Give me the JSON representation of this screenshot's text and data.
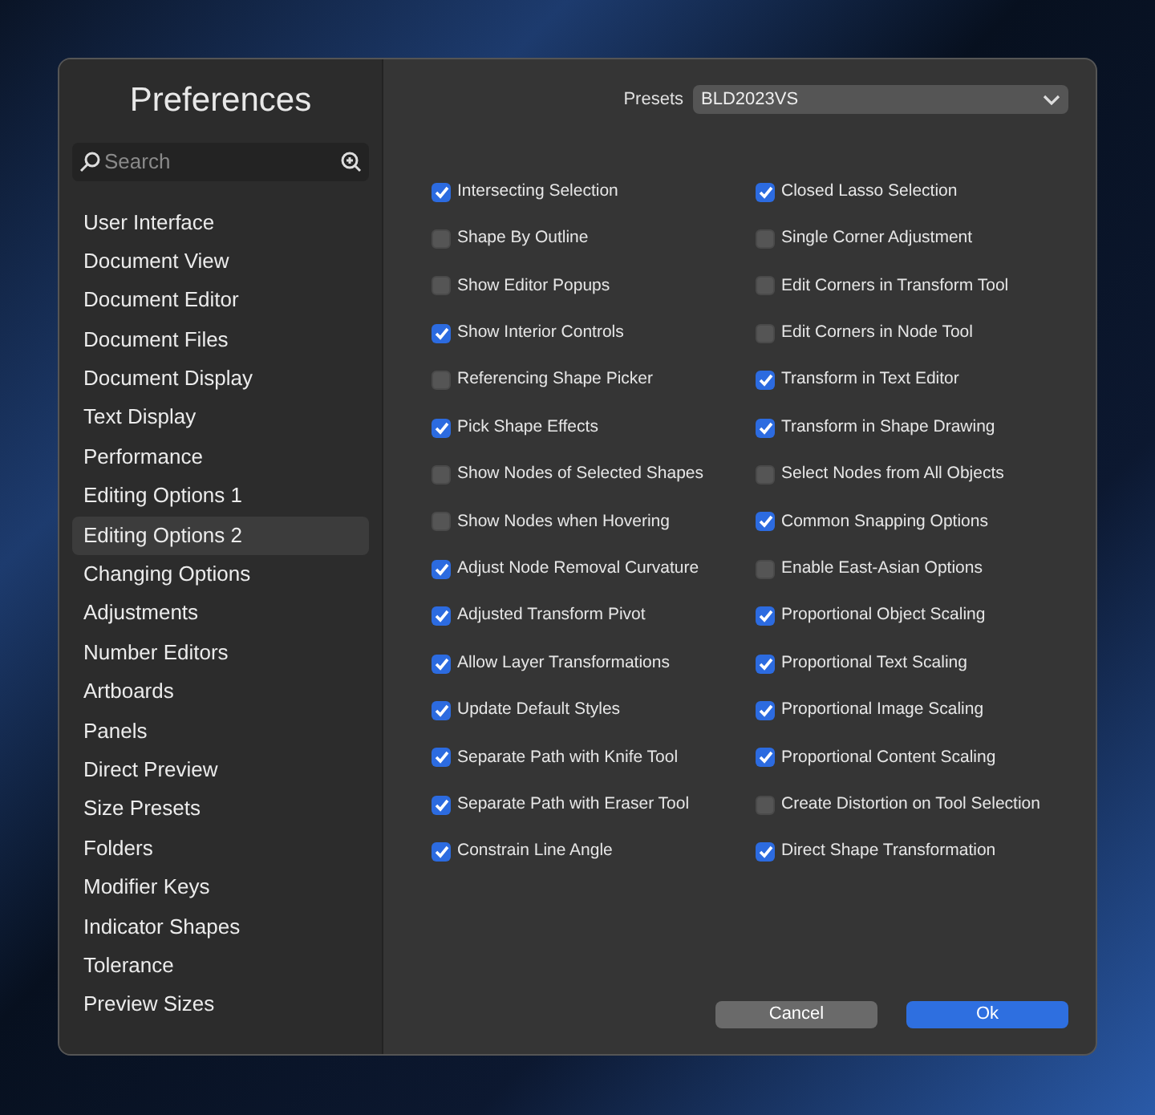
{
  "window": {
    "title": "Preferences"
  },
  "search": {
    "placeholder": "Search"
  },
  "sidebar": {
    "items": [
      {
        "label": "User Interface",
        "selected": false
      },
      {
        "label": "Document View",
        "selected": false
      },
      {
        "label": "Document Editor",
        "selected": false
      },
      {
        "label": "Document Files",
        "selected": false
      },
      {
        "label": "Document Display",
        "selected": false
      },
      {
        "label": "Text Display",
        "selected": false
      },
      {
        "label": "Performance",
        "selected": false
      },
      {
        "label": "Editing Options 1",
        "selected": false
      },
      {
        "label": "Editing Options 2",
        "selected": true
      },
      {
        "label": "Changing Options",
        "selected": false
      },
      {
        "label": "Adjustments",
        "selected": false
      },
      {
        "label": "Number Editors",
        "selected": false
      },
      {
        "label": "Artboards",
        "selected": false
      },
      {
        "label": "Panels",
        "selected": false
      },
      {
        "label": "Direct Preview",
        "selected": false
      },
      {
        "label": "Size Presets",
        "selected": false
      },
      {
        "label": "Folders",
        "selected": false
      },
      {
        "label": "Modifier Keys",
        "selected": false
      },
      {
        "label": "Indicator Shapes",
        "selected": false
      },
      {
        "label": "Tolerance",
        "selected": false
      },
      {
        "label": "Preview Sizes",
        "selected": false
      }
    ]
  },
  "presets": {
    "label": "Presets",
    "value": "BLD2023VS"
  },
  "options": [
    {
      "label": "Intersecting Selection",
      "checked": true
    },
    {
      "label": "Closed Lasso Selection",
      "checked": true
    },
    {
      "label": "Shape By Outline",
      "checked": false
    },
    {
      "label": "Single Corner Adjustment",
      "checked": false
    },
    {
      "label": "Show Editor Popups",
      "checked": false
    },
    {
      "label": "Edit Corners in Transform Tool",
      "checked": false
    },
    {
      "label": "Show Interior Controls",
      "checked": true
    },
    {
      "label": "Edit Corners in Node Tool",
      "checked": false
    },
    {
      "label": "Referencing Shape Picker",
      "checked": false
    },
    {
      "label": "Transform in Text Editor",
      "checked": true
    },
    {
      "label": "Pick Shape Effects",
      "checked": true
    },
    {
      "label": "Transform in Shape Drawing",
      "checked": true
    },
    {
      "label": "Show Nodes of Selected Shapes",
      "checked": false
    },
    {
      "label": "Select Nodes from All Objects",
      "checked": false
    },
    {
      "label": "Show Nodes when Hovering",
      "checked": false
    },
    {
      "label": "Common Snapping Options",
      "checked": true
    },
    {
      "label": "Adjust Node Removal Curvature",
      "checked": true
    },
    {
      "label": "Enable East-Asian Options",
      "checked": false
    },
    {
      "label": "Adjusted Transform Pivot",
      "checked": true
    },
    {
      "label": "Proportional Object Scaling",
      "checked": true
    },
    {
      "label": "Allow Layer Transformations",
      "checked": true
    },
    {
      "label": "Proportional Text Scaling",
      "checked": true
    },
    {
      "label": "Update Default Styles",
      "checked": true
    },
    {
      "label": "Proportional Image Scaling",
      "checked": true
    },
    {
      "label": "Separate Path with Knife Tool",
      "checked": true
    },
    {
      "label": "Proportional Content Scaling",
      "checked": true
    },
    {
      "label": "Separate Path with Eraser Tool",
      "checked": true
    },
    {
      "label": "Create Distortion on Tool Selection",
      "checked": false
    },
    {
      "label": "Constrain Line Angle",
      "checked": true
    },
    {
      "label": "Direct Shape Transformation",
      "checked": true
    }
  ],
  "buttons": [
    {
      "label": "Cancel",
      "kind": "secondary"
    },
    {
      "label": "Ok",
      "kind": "primary"
    }
  ]
}
